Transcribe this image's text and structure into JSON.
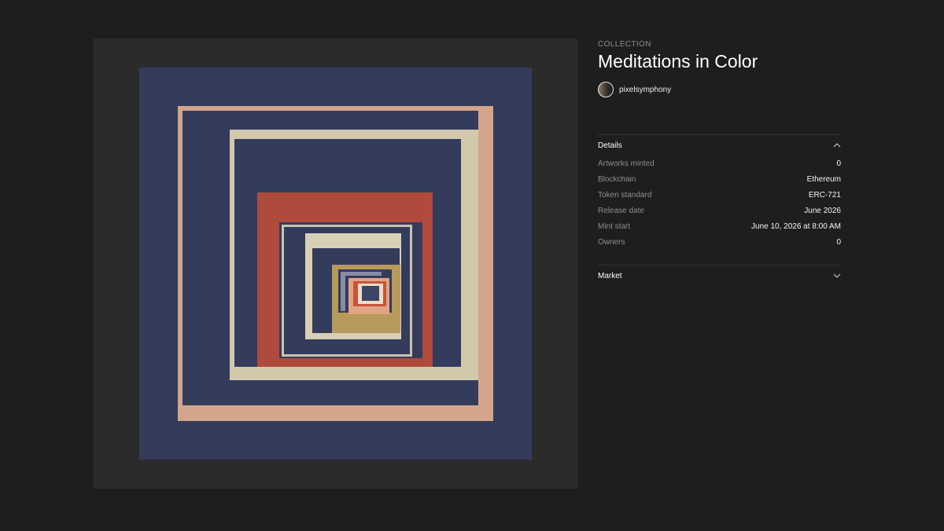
{
  "collection": {
    "eyebrow": "COLLECTION",
    "title": "Meditations in Color",
    "creator": "pixelsymphony"
  },
  "details": {
    "heading": "Details",
    "expanded": true,
    "rows": [
      {
        "label": "Artworks minted",
        "value": "0"
      },
      {
        "label": "Blockchain",
        "value": "Ethereum"
      },
      {
        "label": "Token standard",
        "value": "ERC-721"
      },
      {
        "label": "Release date",
        "value": "June 2026"
      },
      {
        "label": "Mint start",
        "value": "June 10, 2026 at 8:00 AM"
      },
      {
        "label": "Owners",
        "value": "0"
      }
    ]
  },
  "market": {
    "heading": "Market",
    "expanded": false
  },
  "icons": {
    "details_toggle": "chevron-up-icon",
    "market_toggle": "chevron-down-icon"
  },
  "colors": {
    "page_background": "#1e1e1e",
    "panel_background": "#2b2b2b",
    "artwork_navy": "#343c5c",
    "artwork_peach": "#d4a58a",
    "artwork_cream": "#d2c9ac",
    "artwork_red": "#b04a3c",
    "artwork_ochre": "#b59a5c"
  }
}
